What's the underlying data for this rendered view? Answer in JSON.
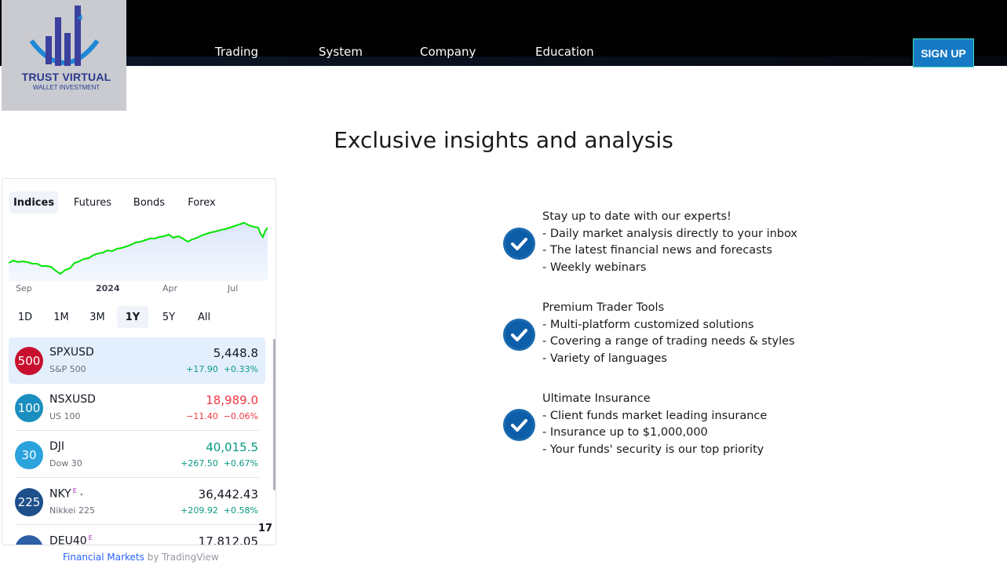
{
  "logo": {
    "line1": "TRUST VIRTUAL",
    "line2": "WALLET INVESTMENT"
  },
  "nav": [
    "Trading",
    "System",
    "Company",
    "Education"
  ],
  "signup_label": "SIGN UP",
  "headline": "Exclusive insights and analysis",
  "widget": {
    "tabs": [
      "Indices",
      "Futures",
      "Bonds",
      "Forex"
    ],
    "active_tab": "Indices",
    "chart_x_labels": [
      "Sep",
      "2024",
      "Apr",
      "Jul"
    ],
    "ranges": [
      "1D",
      "1M",
      "3M",
      "1Y",
      "5Y",
      "All"
    ],
    "active_range": "1Y",
    "rows": [
      {
        "badge": "500",
        "symbol": "SPXUSD",
        "flag": "",
        "name": "S&P 500",
        "price": "5,448.8",
        "change": "+17.90",
        "percent": "+0.33%",
        "dir": "pos",
        "badge_color": "#c8102e"
      },
      {
        "badge": "100",
        "symbol": "NSXUSD",
        "flag": "",
        "name": "US 100",
        "price": "18,989.0",
        "change": "−11.40",
        "percent": "−0.06%",
        "dir": "neg",
        "badge_color": "#1a8fbf"
      },
      {
        "badge": "30",
        "symbol": "DJI",
        "flag": "",
        "name": "Dow 30",
        "price": "40,015.5",
        "change": "+267.50",
        "percent": "+0.67%",
        "dir": "pos",
        "badge_color": "#2aa3dc"
      },
      {
        "badge": "225",
        "symbol": "NKY",
        "flag": "E",
        "name": "Nikkei 225",
        "price": "36,442.43",
        "change": "+209.92",
        "percent": "+0.58%",
        "dir": "pos",
        "badge_color": "#1d4f8a"
      },
      {
        "badge": "",
        "symbol": "DEU40",
        "flag": "E",
        "name": "",
        "price": "17,812.05",
        "change": "",
        "percent": "",
        "dir": "pos",
        "badge_color": "#2d5ea6"
      }
    ],
    "tv_logo": "17",
    "credit_link": "Financial Markets",
    "credit_by": "by TradingView"
  },
  "features": [
    {
      "lines": [
        "Stay up to date with our experts!",
        "- Daily market analysis directly to your inbox",
        "- The latest financial news and forecasts",
        "- Weekly webinars"
      ]
    },
    {
      "lines": [
        "Premium Trader Tools",
        "- Multi-platform customized solutions",
        "- Covering a range of trading needs & styles",
        "- Variety of languages"
      ]
    },
    {
      "lines": [
        "Ultimate Insurance",
        "- Client funds market leading insurance",
        "- Insurance up to $1,000,000",
        "- Your funds' security is our top priority"
      ]
    }
  ],
  "colors": {
    "accent": "#1579c4",
    "check": "#0d5ea8",
    "line": "#00e600",
    "positive": "#089981",
    "negative": "#f23645"
  }
}
